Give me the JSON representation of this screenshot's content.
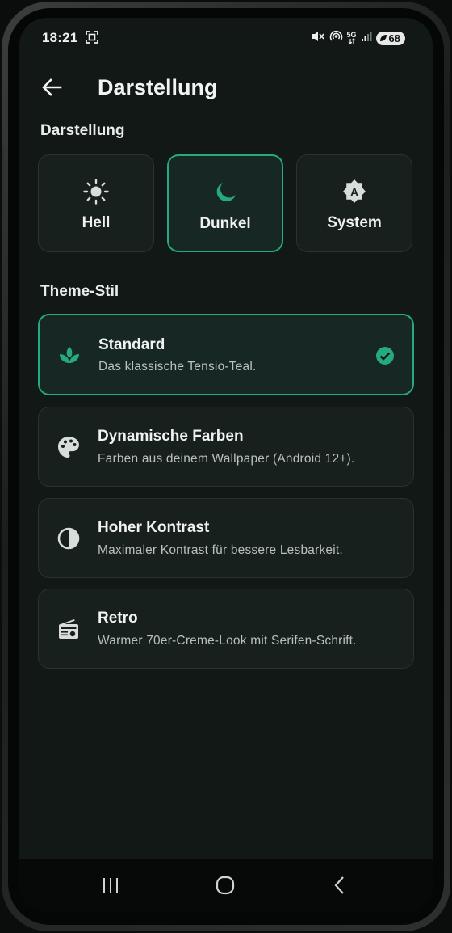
{
  "status_bar": {
    "time": "18:21",
    "battery": "68",
    "network": "5G"
  },
  "header": {
    "title": "Darstellung"
  },
  "appearance": {
    "section_title": "Darstellung",
    "modes": [
      {
        "label": "Hell",
        "icon": "sun-icon",
        "selected": false
      },
      {
        "label": "Dunkel",
        "icon": "moon-icon",
        "selected": true
      },
      {
        "label": "System",
        "icon": "auto-mode-icon",
        "selected": false
      }
    ]
  },
  "theme_style": {
    "section_title": "Theme-Stil",
    "options": [
      {
        "title": "Standard",
        "description": "Das klassische Tensio-Teal.",
        "icon": "spa-leaf-icon",
        "selected": true
      },
      {
        "title": "Dynamische Farben",
        "description": "Farben aus deinem Wallpaper (Android 12+).",
        "icon": "palette-icon",
        "selected": false
      },
      {
        "title": "Hoher Kontrast",
        "description": "Maximaler Kontrast für bessere Lesbarkeit.",
        "icon": "contrast-icon",
        "selected": false
      },
      {
        "title": "Retro",
        "description": "Warmer 70er-Creme-Look mit Serifen-Schrift.",
        "icon": "radio-icon",
        "selected": false
      }
    ]
  },
  "colors": {
    "accent": "#25a980",
    "background": "#121816",
    "card": "#18201e"
  }
}
